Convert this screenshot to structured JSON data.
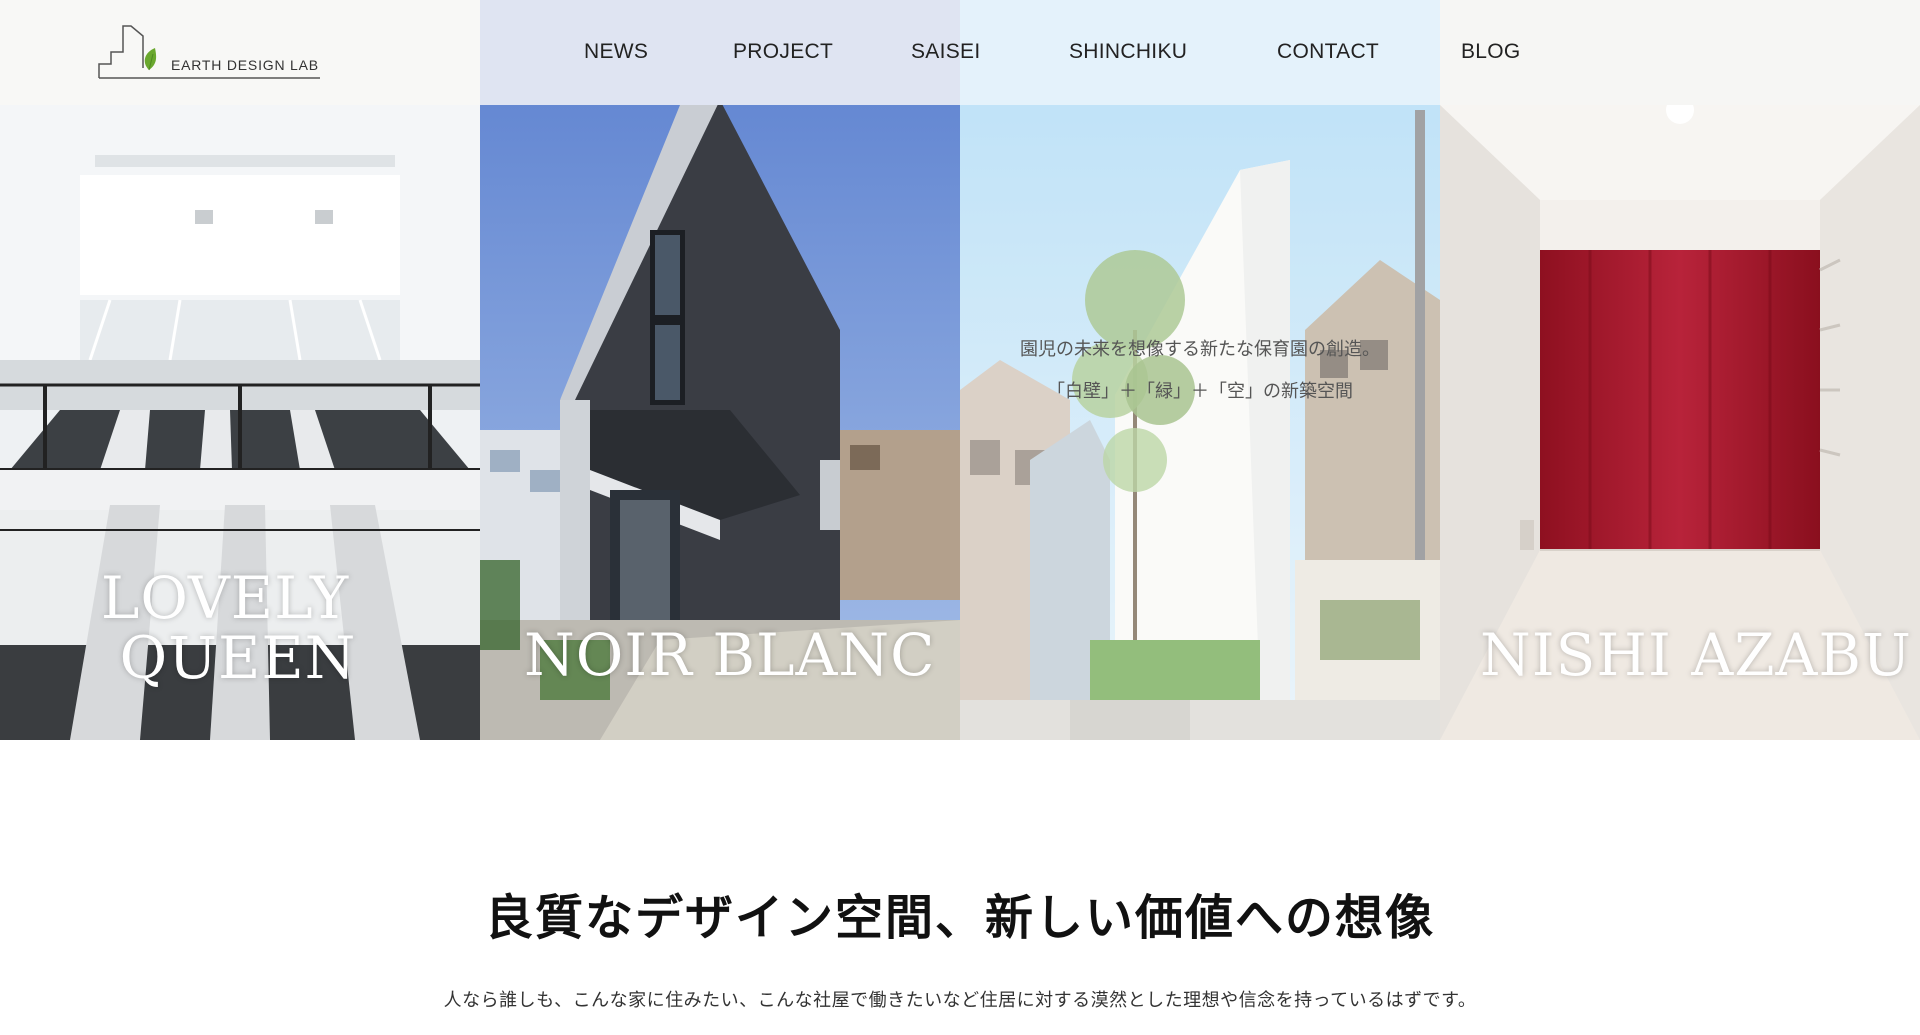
{
  "brand": {
    "logo_text": "EARTH DESIGN LAB"
  },
  "nav": {
    "items": [
      {
        "label": "NEWS"
      },
      {
        "label": "PROJECT"
      },
      {
        "label": "SAISEI"
      },
      {
        "label": "SHINCHIKU"
      },
      {
        "label": "CONTACT"
      },
      {
        "label": "BLOG"
      }
    ]
  },
  "panels": [
    {
      "title_line1": "LOVELY",
      "title_line2": "QUEEN"
    },
    {
      "title": "NOIR BLANC"
    },
    {
      "caption_line1": "園児の未来を想像する新たな保育園の創造。",
      "caption_line2": "「白壁」＋「緑」＋「空」の新築空間"
    },
    {
      "title": "NISHI AZABU"
    }
  ],
  "intro": {
    "heading": "良質なデザイン空間、新しい価値への想像",
    "text": "人なら誰しも、こんな家に住みたい、こんな社屋で働きたいなど住居に対する漠然とした理想や信念を持っているはずです。"
  },
  "colors": {
    "accent_leaf": "#6aa82e",
    "panel4_curtain": "#a3182a",
    "sky_blue": "#5f86d0"
  }
}
